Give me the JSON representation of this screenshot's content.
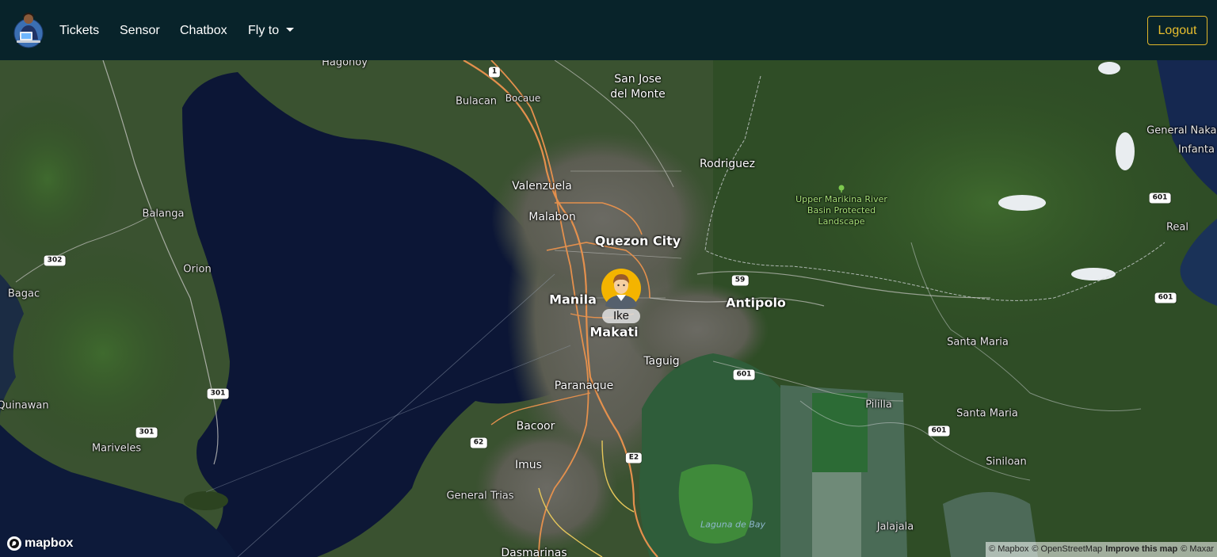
{
  "nav": {
    "items": [
      {
        "label": "Tickets"
      },
      {
        "label": "Sensor"
      },
      {
        "label": "Chatbox"
      },
      {
        "label": "Fly to"
      }
    ],
    "logout_label": "Logout"
  },
  "map": {
    "style": "satellite-streets",
    "labels": {
      "hagonoy": "Hagonoy",
      "san_jose": "San Jose\ndel Monte",
      "bulacan": "Bulacan",
      "bocaue": "Bocaue",
      "rodriguez": "Rodriguez",
      "valenzuela": "Valenzuela",
      "malabon": "Malabon",
      "quezon_city": "Quezon City",
      "balanga": "Balanga",
      "orion": "Orion",
      "bagac": "Bagac",
      "manila": "Manila",
      "makati": "Makati",
      "antipolo": "Antipolo",
      "taguig": "Taguig",
      "paranaque": "Paranaque",
      "quinawan": "Quinawan",
      "mariveles": "Mariveles",
      "bacoor": "Bacoor",
      "imus": "Imus",
      "general_trias": "General Trias",
      "dasmarinas": "Dasmarinas",
      "santa_maria_1": "Santa Maria",
      "santa_maria_2": "Santa Maria",
      "pililla": "Pililla",
      "siniloan": "Siniloan",
      "jalajala": "Jalajala",
      "general_nakar": "General Nakar",
      "infanta": "Infanta",
      "real": "Real",
      "park": "Upper Marikina River Basin Protected Landscape",
      "laguna_de_bay": "Laguna de Bay"
    },
    "shields": {
      "r1": "1",
      "r302": "302",
      "r301a": "301",
      "r301b": "301",
      "r59": "59",
      "r601a": "601",
      "r601b": "601",
      "r601c": "601",
      "r601d": "601",
      "r62": "62",
      "e2": "E2"
    },
    "marker": {
      "name": "Ike",
      "icon": "user-avatar-icon"
    },
    "logo": "mapbox",
    "attribution": [
      "© Mapbox",
      "© OpenStreetMap",
      "Improve this map",
      "© Maxar"
    ]
  },
  "colors": {
    "navbar": "#08232a",
    "logout_accent": "#e0b62a",
    "water": "#0b1533",
    "land": "#36502c",
    "urban": "#5f5e58",
    "road_major": "#e5904f"
  }
}
